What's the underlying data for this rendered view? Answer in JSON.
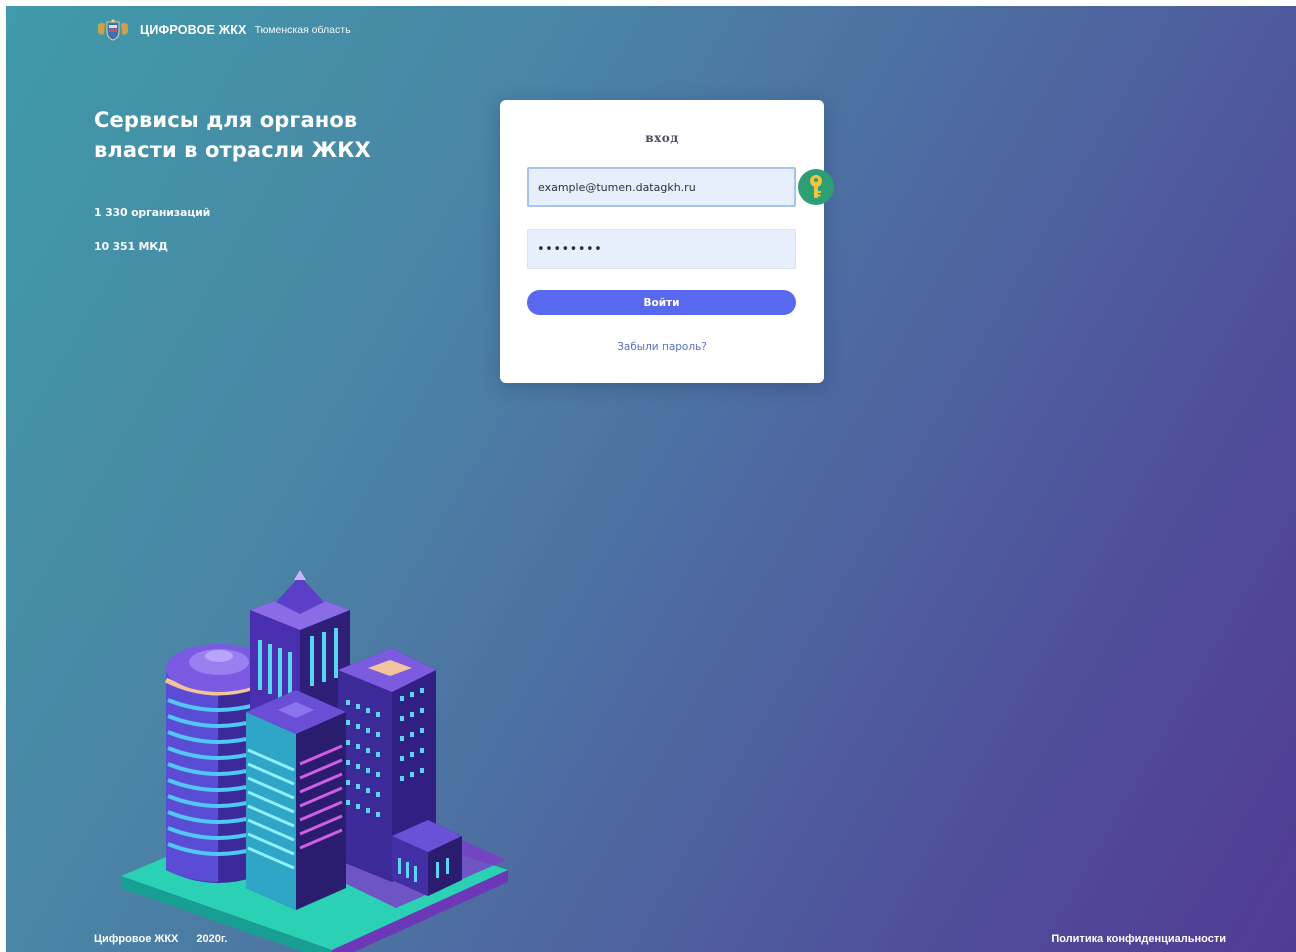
{
  "header": {
    "brand": "ЦИФРОВОЕ ЖКХ",
    "region": "Тюменская область"
  },
  "hero": {
    "title": "Сервисы для органов власти в отрасли ЖКХ",
    "stats": {
      "organizations": "1 330 организаций",
      "buildings": "10 351 МКД"
    }
  },
  "login": {
    "title": "вход",
    "email_value": "example@tumen.datagkh.ru",
    "password_value": "password",
    "submit_label": "Войти",
    "forgot_label": "Забыли пароль?"
  },
  "footer": {
    "brand": "Цифровое ЖКХ",
    "year": "2020г.",
    "privacy_label": "Политика конфиденциальности"
  },
  "colors": {
    "gradient_start": "#3f9aa9",
    "gradient_end": "#523b93",
    "button": "#5869f0",
    "link": "#5a6fd0",
    "input_bg": "#e8effc",
    "key_badge": "#2e9f74"
  },
  "icons": {
    "logo": "coat-of-arms-icon",
    "password_manager": "key-icon",
    "illustration": "isometric-city-illustration"
  }
}
